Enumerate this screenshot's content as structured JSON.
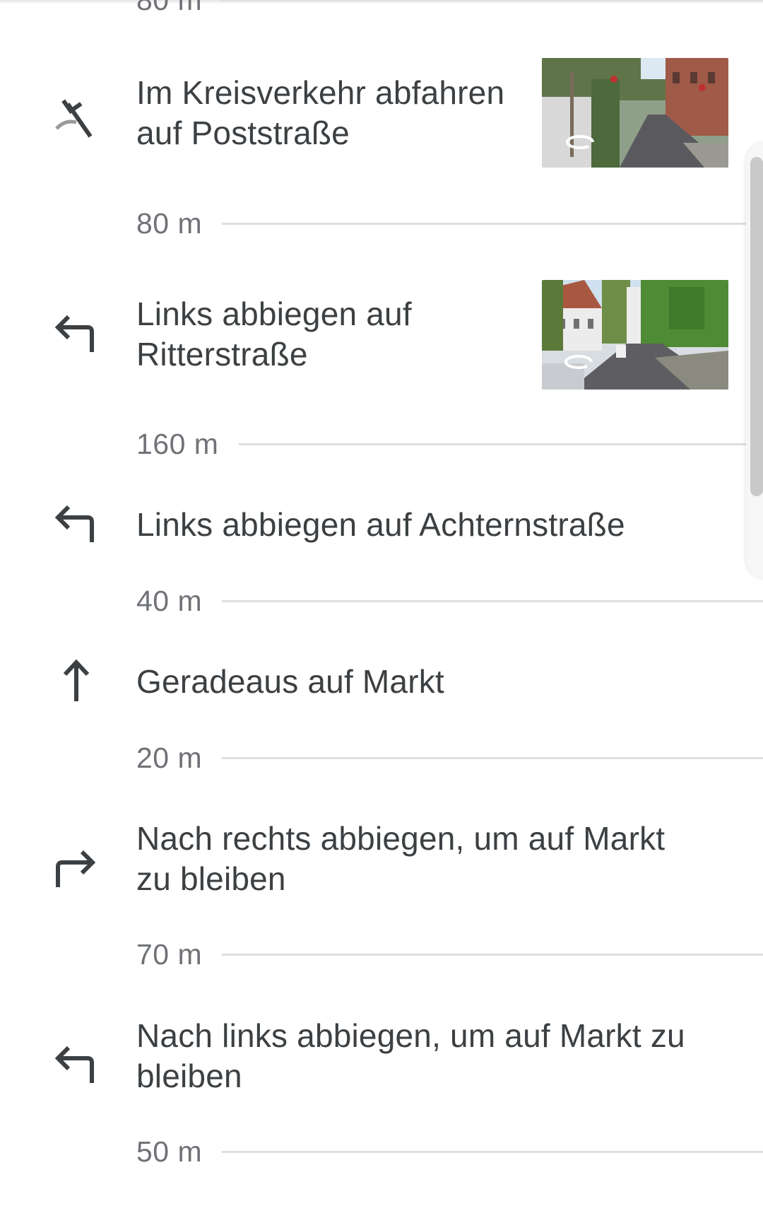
{
  "steps": [
    {
      "distance": "80 m",
      "instruction": "Im Kreisverkehr abfahren auf Poststraße",
      "line1": "Im Kreisverkehr abfahren",
      "line2": "auf Poststraße",
      "icon": "roundabout-exit-icon",
      "has_street_view": true
    },
    {
      "distance": "80 m",
      "instruction": "Links abbiegen auf Ritterstraße",
      "line1": "Links abbiegen auf",
      "line2": "Ritterstraße",
      "icon": "turn-left-icon",
      "has_street_view": true
    },
    {
      "distance": "160 m",
      "instruction": "Links abbiegen auf Achternstraße",
      "icon": "turn-left-icon"
    },
    {
      "distance": "40 m",
      "instruction": "Geradeaus auf Markt",
      "icon": "straight-arrow-icon"
    },
    {
      "distance": "20 m",
      "instruction": "Nach rechts abbiegen, um auf Markt zu bleiben",
      "line1": "Nach rechts abbiegen, um auf Markt",
      "line2": "zu bleiben",
      "icon": "turn-right-icon"
    },
    {
      "distance": "70 m",
      "instruction": "Nach links abbiegen, um auf Markt zu bleiben",
      "line1": "Nach links abbiegen, um auf Markt zu",
      "line2": "bleiben",
      "icon": "turn-left-icon"
    },
    {
      "distance": "50 m"
    }
  ],
  "colors": {
    "text": "#3c4043",
    "distance_text": "#6f7276",
    "divider": "#dedede",
    "icon": "#3c4043"
  }
}
